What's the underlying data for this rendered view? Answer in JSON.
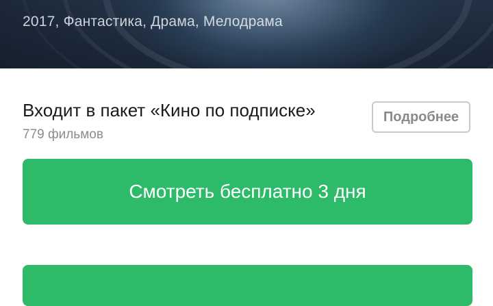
{
  "hero": {
    "meta": "2017, Фантастика, Драма, Мелодрама"
  },
  "package": {
    "title": "Входит в пакет «Кино по подписке»",
    "count": "779 фильмов",
    "more_label": "Подробнее"
  },
  "actions": {
    "watch_label": "Смотреть бесплатно 3 дня"
  },
  "colors": {
    "accent_green": "#2dbb6a",
    "outline_gray": "#c9c9c9"
  }
}
